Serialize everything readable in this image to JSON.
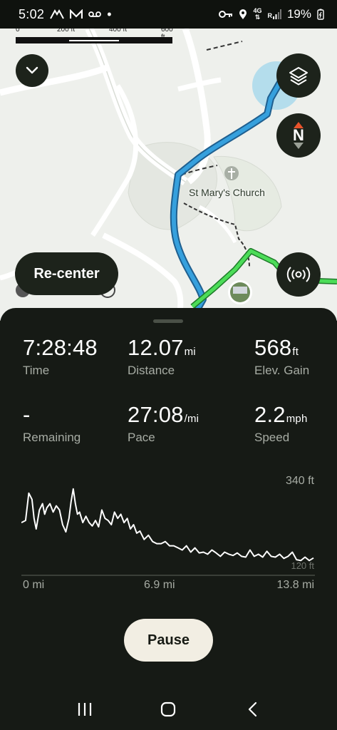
{
  "status_bar": {
    "time": "5:02",
    "battery": "19%",
    "net_4g": "4G",
    "net_r": "R",
    "dot": "•"
  },
  "map": {
    "scale": {
      "ticks": [
        "0",
        "200 ft",
        "400 ft",
        "600 ft"
      ]
    },
    "poi_label": "St Mary's Church",
    "recenter_label": "Re-center",
    "compass_letter": "N",
    "colors": {
      "route": "#2f8fcf",
      "trail": "#3cc94a",
      "accent_north": "#e8532b"
    }
  },
  "stats": [
    {
      "value": "7:28:48",
      "unit": "",
      "label": "Time"
    },
    {
      "value": "12.07",
      "unit": "mi",
      "label": "Distance"
    },
    {
      "value": "568",
      "unit": "ft",
      "label": "Elev. Gain"
    },
    {
      "value": "-",
      "unit": "",
      "label": "Remaining"
    },
    {
      "value": "27:08",
      "unit": "/mi",
      "label": "Pace"
    },
    {
      "value": "2.2",
      "unit": "mph",
      "label": "Speed"
    }
  ],
  "chart_data": {
    "type": "line",
    "xlabel": "",
    "ylabel": "",
    "x_tick_labels": [
      "0 mi",
      "6.9 mi",
      "13.8 mi"
    ],
    "y_tick_labels": [
      "340 ft",
      "120 ft"
    ],
    "xlim": [
      0,
      13.8
    ],
    "ylim": [
      120,
      340
    ],
    "series": [
      {
        "x": [
          0.0,
          0.2,
          0.35,
          0.5,
          0.6,
          0.7,
          0.85,
          1.0,
          1.1,
          1.2,
          1.35,
          1.5,
          1.65,
          1.8,
          1.95,
          2.1,
          2.25,
          2.35,
          2.45,
          2.55,
          2.65,
          2.75,
          2.9,
          3.05,
          3.2,
          3.35,
          3.5,
          3.65,
          3.8,
          3.95,
          4.1,
          4.25,
          4.4,
          4.55,
          4.7,
          4.85,
          5.0,
          5.15,
          5.3,
          5.45,
          5.6,
          5.8,
          6.0,
          6.2,
          6.4,
          6.6,
          6.8,
          7.0,
          7.2,
          7.4,
          7.6,
          7.8,
          8.0,
          8.2,
          8.4,
          8.6,
          8.8,
          9.0,
          9.2,
          9.4,
          9.6,
          9.8,
          10.0,
          10.2,
          10.4,
          10.6,
          10.8,
          11.0,
          11.2,
          11.4,
          11.6,
          11.8,
          12.0,
          12.2,
          12.4,
          12.6,
          12.8,
          13.0,
          13.2,
          13.4,
          13.6,
          13.8
        ],
        "y": [
          240,
          245,
          310,
          295,
          250,
          225,
          270,
          285,
          260,
          275,
          285,
          265,
          280,
          270,
          235,
          218,
          250,
          290,
          320,
          285,
          260,
          265,
          240,
          255,
          240,
          232,
          245,
          230,
          270,
          250,
          245,
          235,
          265,
          250,
          260,
          240,
          250,
          225,
          235,
          215,
          220,
          200,
          210,
          195,
          190,
          190,
          195,
          185,
          185,
          180,
          175,
          185,
          170,
          180,
          168,
          170,
          165,
          175,
          168,
          160,
          170,
          165,
          162,
          168,
          160,
          158,
          175,
          160,
          165,
          158,
          172,
          160,
          158,
          165,
          155,
          160,
          170,
          152,
          150,
          158,
          150,
          156
        ]
      }
    ]
  },
  "actions": {
    "pause_label": "Pause"
  }
}
